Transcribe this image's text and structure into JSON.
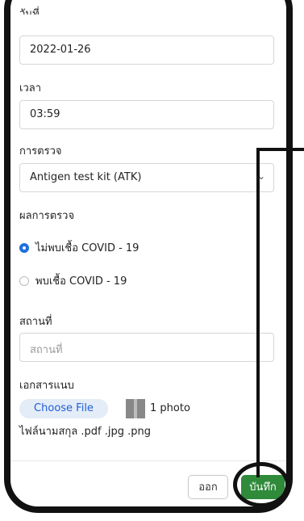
{
  "form": {
    "date_label": "วันที่",
    "date_value": "2022-01-26",
    "time_label": "เวลา",
    "time_value": "03:59",
    "test_label": "การตรวจ",
    "test_value": "Antigen test kit (ATK)",
    "result_label": "ผลการตรวจ",
    "result_options": [
      {
        "label": "ไม่พบเชื้อ COVID - 19",
        "checked": true
      },
      {
        "label": "พบเชื้อ COVID - 19",
        "checked": false
      }
    ],
    "location_label": "สถานที่",
    "location_placeholder": "สถานที่",
    "attachments_label": "เอกสารแนบ",
    "choose_file_label": "Choose File",
    "file_count": "1 photo",
    "file_hint": "ไฟล์นามสกุล .pdf .jpg .png"
  },
  "footer": {
    "cancel_label": "ออก",
    "save_label": "บันทึก"
  },
  "colors": {
    "accent_blue": "#1e6fe0",
    "save_green": "#2f8a3a"
  }
}
